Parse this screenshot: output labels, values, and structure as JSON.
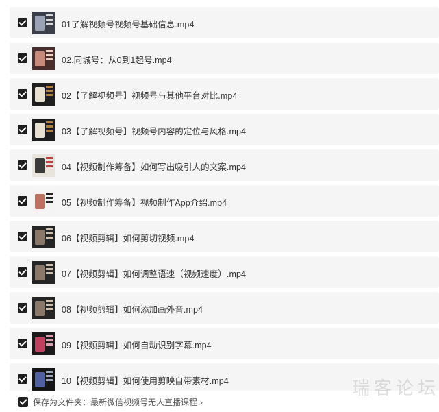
{
  "files": [
    {
      "name": "01了解视频号视频号基础信息.mp4",
      "thumb": {
        "bg": "#3b3f4a",
        "fg": "#9aa3b5",
        "accent": "#d8d8d8"
      }
    },
    {
      "name": "02.同城号：从0到1起号.mp4",
      "thumb": {
        "bg": "#4a2e2e",
        "fg": "#c88a7a",
        "accent": "#f0d0c0"
      }
    },
    {
      "name": "02【了解视频号】视频号与其他平台对比.mp4",
      "thumb": {
        "bg": "#1e1e1e",
        "fg": "#e8e0d0",
        "accent": "#b08040"
      }
    },
    {
      "name": "03【了解视频号】视频号内容的定位与风格.mp4",
      "thumb": {
        "bg": "#1e1e1e",
        "fg": "#e8e0d0",
        "accent": "#b08040"
      }
    },
    {
      "name": "04【视频制作筹备】如何写出吸引人的文案.mp4",
      "thumb": {
        "bg": "#e8e4dc",
        "fg": "#3a3a3a",
        "accent": "#c04040"
      }
    },
    {
      "name": "05【视频制作筹备】视频制作App介绍.mp4",
      "thumb": {
        "bg": "#f4f4f4",
        "fg": "#c07060",
        "accent": "#222222"
      }
    },
    {
      "name": "06【视频剪辑】如何剪切视频.mp4",
      "thumb": {
        "bg": "#252525",
        "fg": "#8a7868",
        "accent": "#d0c0b0"
      }
    },
    {
      "name": "07【视频剪辑】如何调整语速（视频速度）.mp4",
      "thumb": {
        "bg": "#252525",
        "fg": "#8a7868",
        "accent": "#d0c0b0"
      }
    },
    {
      "name": "08【视频剪辑】如何添加画外音.mp4",
      "thumb": {
        "bg": "#252525",
        "fg": "#8a7868",
        "accent": "#d0c0b0"
      }
    },
    {
      "name": "09【视频剪辑】如何自动识别字幕.mp4",
      "thumb": {
        "bg": "#1a1a1a",
        "fg": "#c04060",
        "accent": "#e0a0b0"
      }
    },
    {
      "name": "10【视频剪辑】如何使用剪映自带素材.mp4",
      "thumb": {
        "bg": "#151515",
        "fg": "#5060a0",
        "accent": "#a0a8c0"
      }
    }
  ],
  "footer": {
    "label": "保存为文件夹：最新微信视频号无人直播课程",
    "chevron": "›"
  },
  "watermark": "瑞客论坛"
}
